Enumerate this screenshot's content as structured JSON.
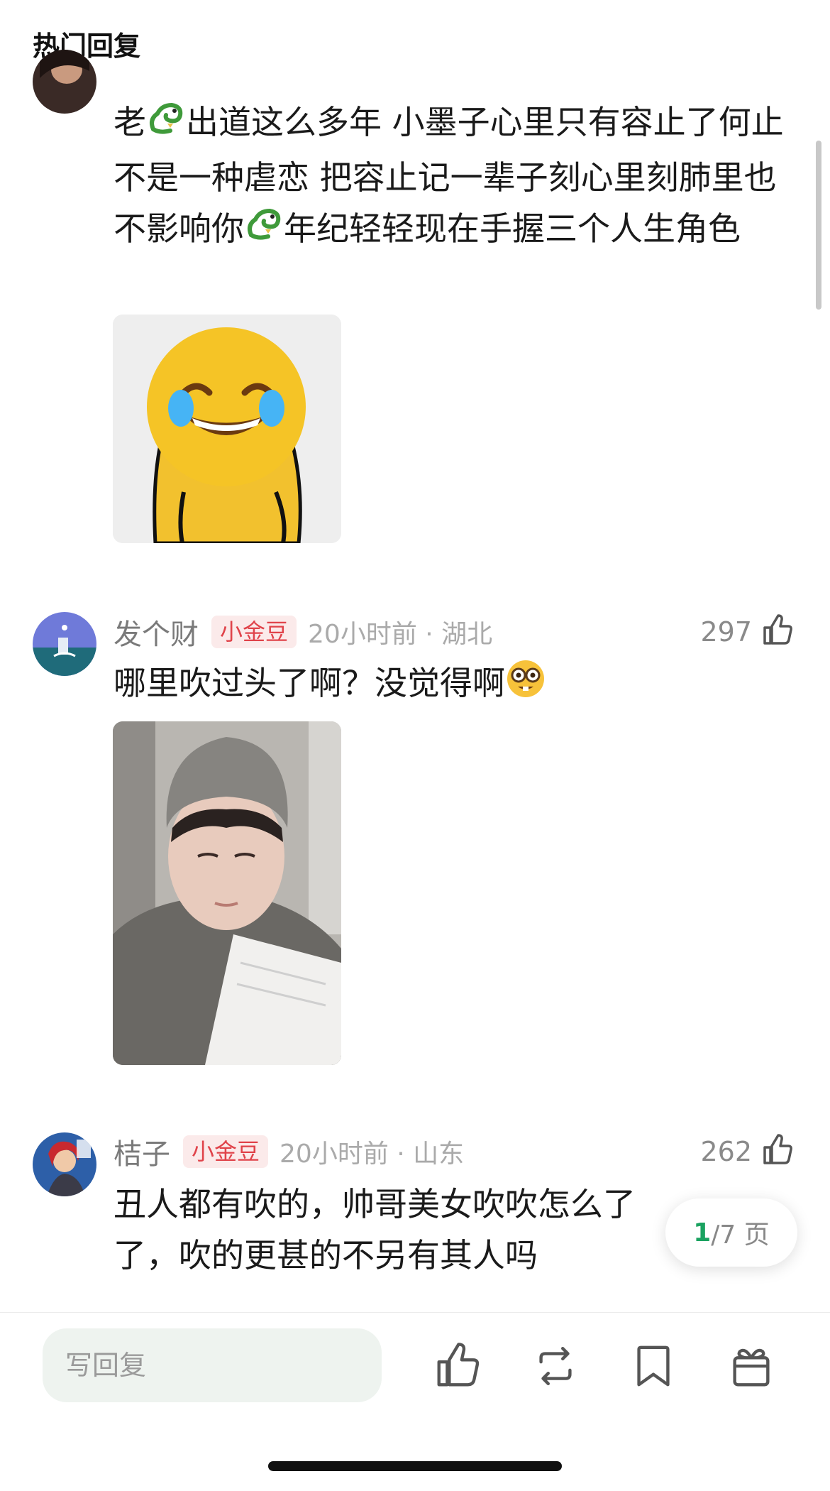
{
  "section_title": "热门回复",
  "comments": [
    {
      "text_part1": "老",
      "text_part2": "出道这么多年 小墨子心里只有容止了何止不是一种虐恋 把容止记一辈子刻心里刻肺里也不影响你",
      "text_part3": "年纪轻轻现在手握三个人生角色",
      "inline_icon": "dragon-emoji-icon",
      "image": "laughing-crying-emoji-sticker"
    },
    {
      "username": "发个财",
      "badge": "小金豆",
      "time_location": "20小时前 · 湖北",
      "likes": "297",
      "text": "哪里吹过头了啊？没觉得啊",
      "inline_icon": "nerd-face-emoji-icon",
      "image": "boy-in-beanie-reading-photo"
    },
    {
      "username": "桔子",
      "badge": "小金豆",
      "time_location": "20小时前 · 山东",
      "likes": "262",
      "text_line1": "丑人都有吹的，帅哥美女吹吹怎么了",
      "text_line2": "了，吹的更甚的不另有其人吗"
    }
  ],
  "pagination": {
    "current": "1",
    "total_suffix": "/7 页"
  },
  "bottom_bar": {
    "reply_placeholder": "写回复",
    "icons": [
      "thumbs-up-icon",
      "repost-icon",
      "bookmark-icon",
      "gift-icon"
    ]
  }
}
